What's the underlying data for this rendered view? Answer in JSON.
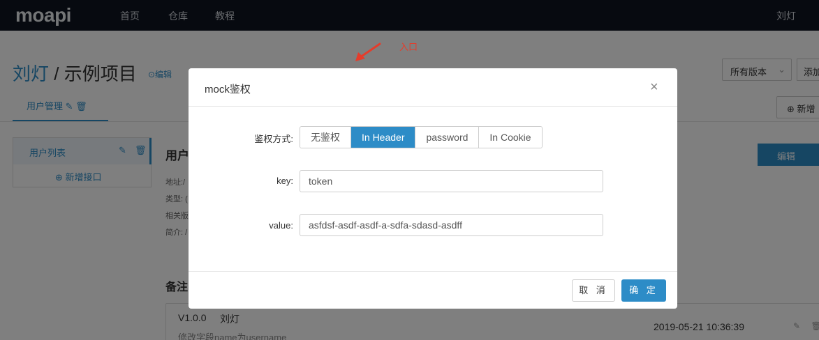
{
  "nav": {
    "logo": "moapi",
    "items": [
      "首页",
      "仓库",
      "教程"
    ],
    "user": "刘灯"
  },
  "project": {
    "owner": "刘灯",
    "name": "示例项目",
    "separator": " / ",
    "edit_label": "⊙编辑",
    "version_select": "所有版本",
    "add_label": "添加",
    "new_label": "⊕ 新增"
  },
  "tabs": [
    {
      "label": "用户管理 ✎ 🗑"
    }
  ],
  "sidebar": {
    "items": [
      {
        "label": "用户列表"
      }
    ],
    "add_label": "⊕ 新增接口"
  },
  "api": {
    "title": "用户",
    "meta": [
      "地址:/",
      "类型: (",
      "相关版",
      "简介: /"
    ],
    "edit_label": "编辑"
  },
  "notes": {
    "title": "备注",
    "entry": {
      "version": "V1.0.0",
      "author": "刘灯",
      "desc": "修改字段name为username",
      "time": "2019-05-21 10:36:39"
    }
  },
  "annotation": {
    "label": "入口",
    "color": "#e53c2b"
  },
  "modal": {
    "title": "mock鉴权",
    "auth_label": "鉴权方式",
    "auth_options": [
      "无鉴权",
      "In Header",
      "password",
      "In Cookie"
    ],
    "auth_selected": "In Header",
    "key_label": "key",
    "key_value": "token",
    "value_label": "value",
    "value_value": "asfdsf-asdf-asdf-a-sdfa-sdasd-asdff",
    "cancel_label": "取 消",
    "ok_label": "确 定"
  },
  "colors": {
    "accent": "#2d8cc7",
    "nav_bg": "#0f1521",
    "overlay": "rgba(0,0,0,0.5)"
  }
}
